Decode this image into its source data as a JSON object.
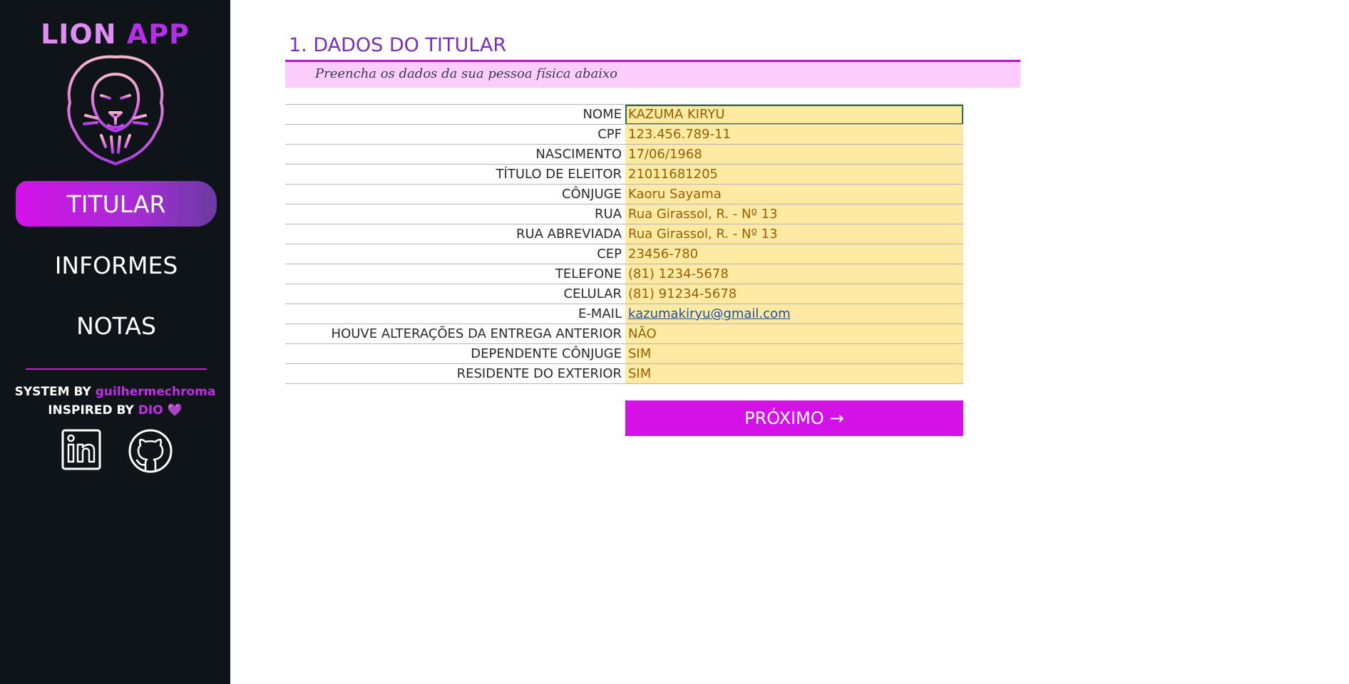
{
  "app": {
    "brand_part1": "LION",
    "brand_part2": "APP"
  },
  "sidebar": {
    "nav": [
      {
        "label": "TITULAR",
        "active": true
      },
      {
        "label": "INFORMES",
        "active": false
      },
      {
        "label": "NOTAS",
        "active": false
      }
    ],
    "credits": {
      "system_prefix": "SYSTEM BY",
      "system_author": "guilhermechroma",
      "inspired_prefix": "INSPIRED BY",
      "inspired_name": "DIO",
      "heart": "💜"
    },
    "social": [
      "linkedin-icon",
      "github-icon"
    ]
  },
  "main": {
    "title": "1. DADOS DO TITULAR",
    "subtitle": "Preencha os dados da sua pessoa física abaixo",
    "fields": [
      {
        "label": "NOME",
        "value": "KAZUMA KIRYU"
      },
      {
        "label": "CPF",
        "value": "123.456.789-11"
      },
      {
        "label": "NASCIMENTO",
        "value": "17/06/1968"
      },
      {
        "label": "TÍTULO DE ELEITOR",
        "value": "21011681205"
      },
      {
        "label": "CÔNJUGE",
        "value": "Kaoru Sayama"
      },
      {
        "label": "RUA",
        "value": "Rua Girassol, R. - Nº 13"
      },
      {
        "label": "RUA ABREVIADA",
        "value": "Rua Girassol, R. - Nº 13"
      },
      {
        "label": "CEP",
        "value": "23456-780"
      },
      {
        "label": "TELEFONE",
        "value": "(81) 1234-5678"
      },
      {
        "label": "CELULAR",
        "value": "(81) 91234-5678"
      },
      {
        "label": "E-MAIL",
        "value": "kazumakiryu@gmail.com"
      },
      {
        "label": "HOUVE ALTERAÇÕES DA ENTREGA ANTERIOR",
        "value": "NÃO"
      },
      {
        "label": "DEPENDENTE CÔNJUGE",
        "value": "SIM"
      },
      {
        "label": "RESIDENTE DO EXTERIOR",
        "value": "SIM"
      }
    ],
    "next_button": "PRÓXIMO",
    "next_arrow": "→"
  },
  "colors": {
    "sidebar_bg": "#0f1418",
    "accent": "#d412e8",
    "value_bg": "#ffeaa4",
    "subtitle_band": "#fccdfc"
  }
}
